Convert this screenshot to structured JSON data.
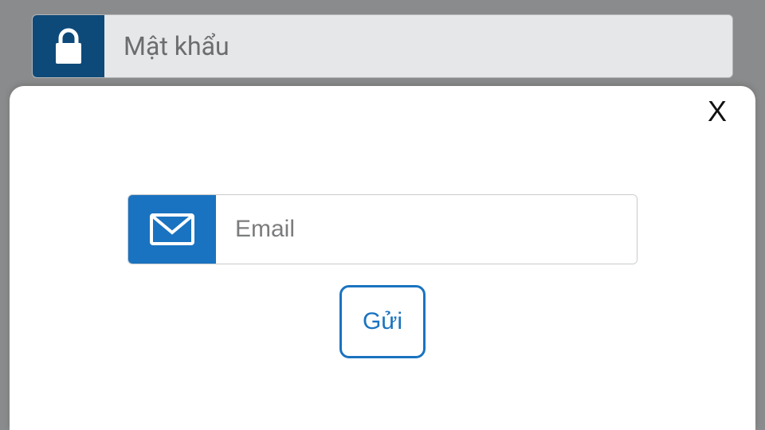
{
  "background": {
    "password_placeholder": "Mật khẩu"
  },
  "modal": {
    "close_label": "X",
    "email_placeholder": "Email",
    "email_value": "",
    "send_label": "Gửi"
  }
}
